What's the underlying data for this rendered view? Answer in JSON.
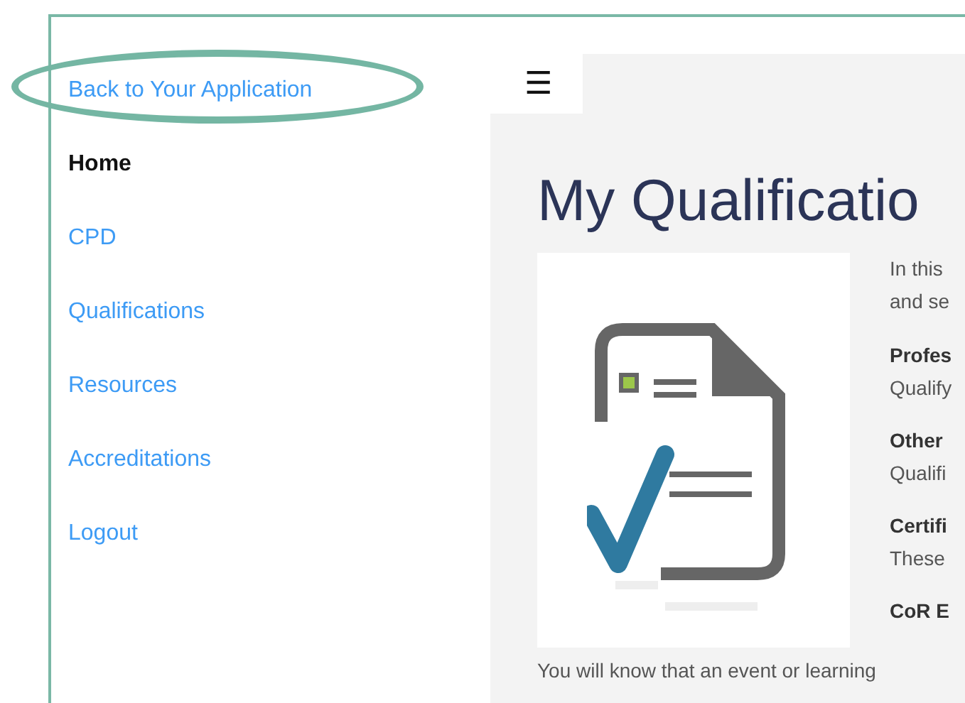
{
  "sidebar": {
    "items": [
      {
        "label": "Back to Your Application",
        "selected": false,
        "highlighted": true
      },
      {
        "label": "Home",
        "selected": true,
        "highlighted": false
      },
      {
        "label": "CPD",
        "selected": false,
        "highlighted": false
      },
      {
        "label": "Qualifications",
        "selected": false,
        "highlighted": false
      },
      {
        "label": "Resources",
        "selected": false,
        "highlighted": false
      },
      {
        "label": "Accreditations",
        "selected": false,
        "highlighted": false
      },
      {
        "label": "Logout",
        "selected": false,
        "highlighted": false
      }
    ]
  },
  "menu_button": {
    "label": "☰"
  },
  "page": {
    "title": "My Qualificatio",
    "intro": [
      "In this",
      "and se"
    ],
    "sections": [
      {
        "heading": "Profes",
        "text": "Qualify"
      },
      {
        "heading": "Other",
        "text": "Qualifi"
      },
      {
        "heading": "Certifi",
        "text": "These"
      },
      {
        "heading": "CoR E"
      }
    ],
    "footer_text": "You will know that an event or learning"
  }
}
